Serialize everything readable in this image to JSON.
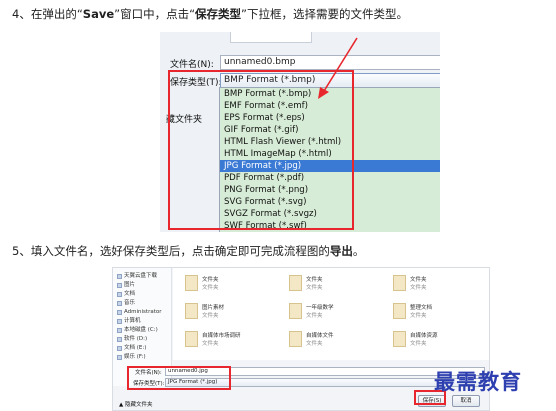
{
  "step4": {
    "prefix": "4、在弹出的“",
    "save": "Save",
    "mid": "”窗口中，点击“",
    "type": "保存类型",
    "suffix": "”下拉框，选择需要的文件类型。"
  },
  "dialog1": {
    "filename_label": "文件名(N):",
    "filename_value": "unnamed0.bmp",
    "type_label": "保存类型(T):",
    "type_value": "BMP Format (*.bmp)",
    "side_label": "藏文件夹",
    "options": [
      "BMP Format (*.bmp)",
      "EMF Format (*.emf)",
      "EPS Format (*.eps)",
      "GIF Format (*.gif)",
      "HTML Flash Viewer (*.html)",
      "HTML ImageMap (*.html)",
      "JPG Format (*.jpg)",
      "PDF Format (*.pdf)",
      "PNG Format (*.png)",
      "SVG Format (*.svg)",
      "SVGZ Format (*.svgz)",
      "SWF Format (*.swf)"
    ],
    "selected_index": 6
  },
  "step5": {
    "prefix": "5、填入文件名，选好保存类型后，点击确定即可完成流程图的",
    "bold": "导出",
    "suffix": "。"
  },
  "dialog2": {
    "nav": [
      "天翼云盘下载",
      "图片",
      "文档",
      "音乐",
      "Administrator",
      "计算机",
      "本地磁盘 (C:)",
      "软件 (D:)",
      "文档 (E:)",
      "娱乐 (F:)"
    ],
    "files": [
      {
        "name": "文件夹",
        "sub": "文件夹"
      },
      {
        "name": "文件夹",
        "sub": "文件夹"
      },
      {
        "name": "文件夹",
        "sub": "文件夹"
      },
      {
        "name": "图片素材",
        "sub": "文件夹"
      },
      {
        "name": "一年级数学",
        "sub": "文件夹"
      },
      {
        "name": "整理文档",
        "sub": "文件夹"
      },
      {
        "name": "自媒体市场调研",
        "sub": "文件夹"
      },
      {
        "name": "自媒体文件",
        "sub": "文件夹"
      },
      {
        "name": "自媒体资源",
        "sub": "文件夹"
      }
    ],
    "filename_label": "文件名(N):",
    "filename_value": "unnamed0.jpg",
    "type_label": "保存类型(T):",
    "type_value": "JPG Format (*.jpg)",
    "hide_folders": "隐藏文件夹",
    "save_button": "保存(S)",
    "cancel_button": "取消"
  },
  "watermark": "最需教育",
  "colors": {
    "highlight": "#e8262d",
    "selected": "#3a79d4",
    "list_bg": "#d7ecd6",
    "watermark": "#2e3fb0"
  }
}
